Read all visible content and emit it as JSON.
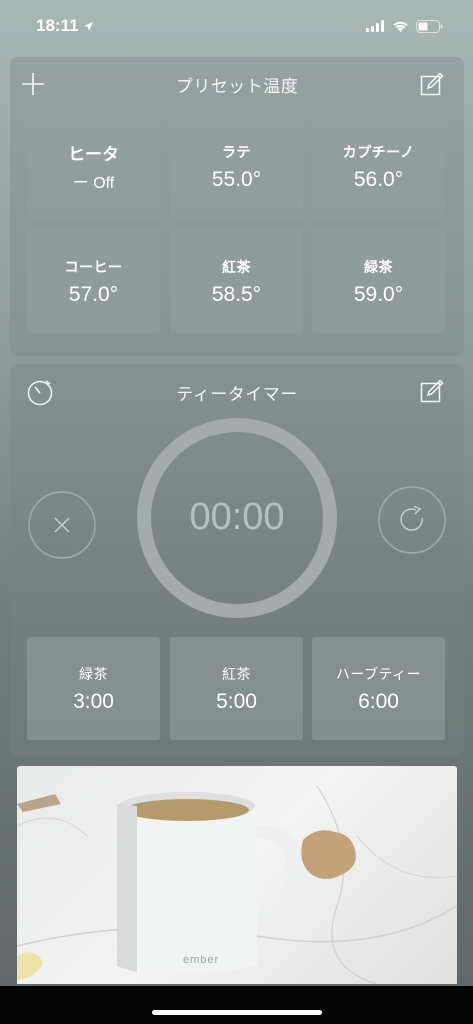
{
  "status_bar": {
    "time": "18:11"
  },
  "preset_panel": {
    "title": "プリセット温度",
    "tiles": [
      {
        "name": "ヒータ",
        "value": "ー Off"
      },
      {
        "name": "ラテ",
        "value": "55.0°"
      },
      {
        "name": "カプチーノ",
        "value": "56.0°"
      },
      {
        "name": "コーヒー",
        "value": "57.0°"
      },
      {
        "name": "紅茶",
        "value": "58.5°"
      },
      {
        "name": "緑茶",
        "value": "59.0°"
      }
    ]
  },
  "timer_panel": {
    "title": "ティータイマー",
    "display": "00:00",
    "presets": [
      {
        "name": "緑茶",
        "value": "3:00"
      },
      {
        "name": "紅茶",
        "value": "5:00"
      },
      {
        "name": "ハーブティー",
        "value": "6:00"
      }
    ]
  },
  "photo": {
    "mug_brand": "ember"
  },
  "colors": {
    "accent_ring": "#a3abab",
    "tile_bg": "#9aa3a3"
  }
}
